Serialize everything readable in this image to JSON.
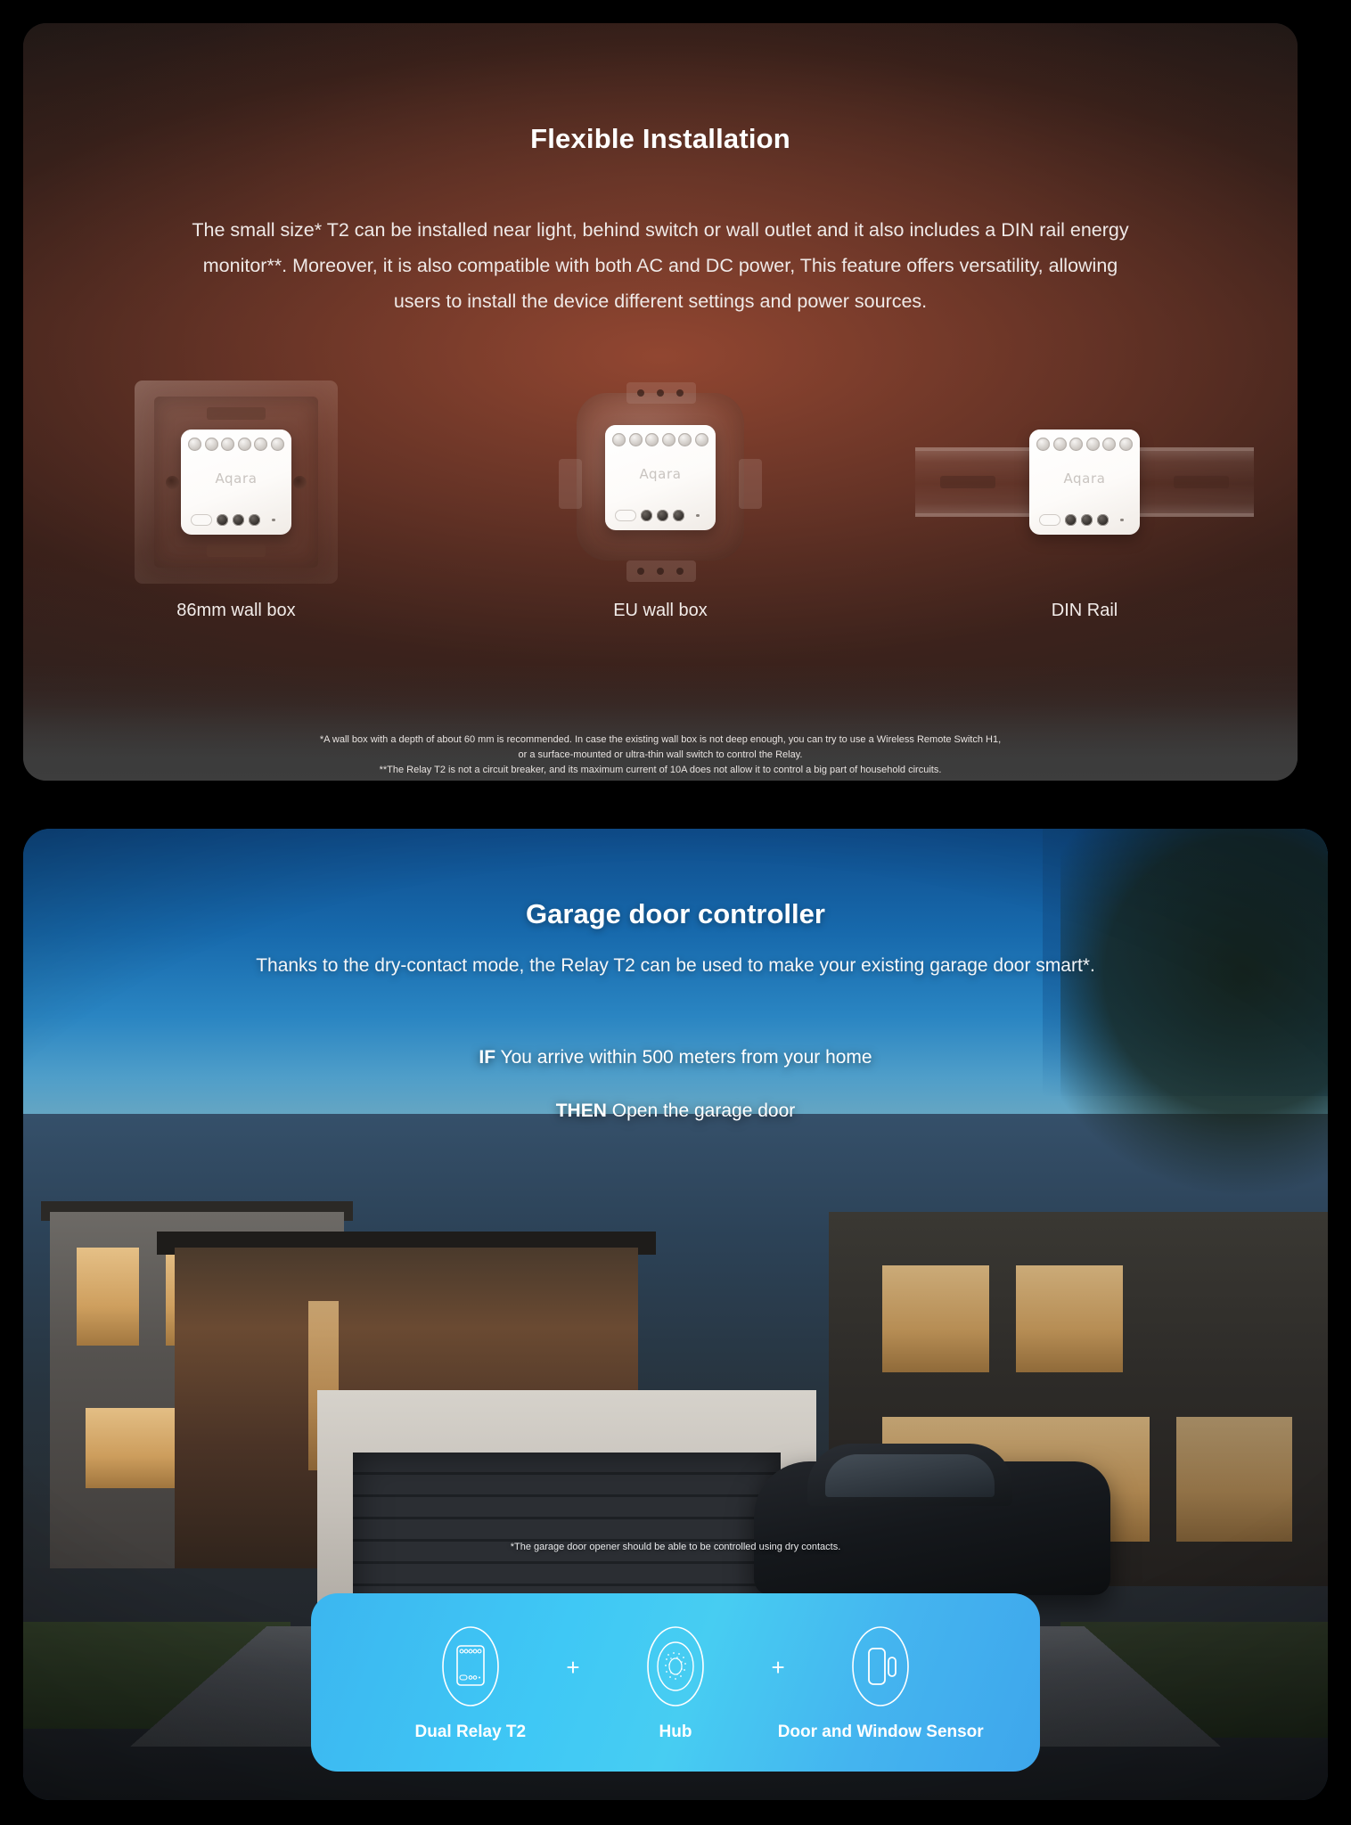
{
  "page": {
    "background_color": "#000000"
  },
  "section1": {
    "title": "Flexible Installation",
    "paragraph": "The small size* T2 can be installed near light, behind switch or wall outlet and it also includes a DIN rail energy monitor**. Moreover, it is also compatible with both AC and DC power, This feature offers versatility, allowing users to install the device different settings and power sources.",
    "devices": [
      {
        "label": "86mm wall box",
        "icon": "wall-box-86mm-icon",
        "brand": "Aqara"
      },
      {
        "label": "EU wall box",
        "icon": "eu-wall-box-icon",
        "brand": "Aqara"
      },
      {
        "label": "DIN Rail",
        "icon": "din-rail-icon",
        "brand": "Aqara"
      }
    ],
    "footnotes": [
      "*A wall box with a depth of about 60 mm is recommended. In case the existing wall box is not deep enough, you can try to use a Wireless Remote Switch H1,",
      "or a surface-mounted or ultra-thin wall switch to control the Relay.",
      "**The Relay T2 is not a circuit breaker, and its maximum current of 10A does not allow it to control a big part of household circuits."
    ],
    "accent_color": "#8a4634"
  },
  "section2": {
    "title": "Garage door controller",
    "subtitle": "Thanks to the dry-contact mode, the Relay T2 can be used to make your existing garage door smart*.",
    "automation": {
      "if_keyword": "IF",
      "if_text": "You arrive within 500 meters from your home",
      "then_keyword": "THEN",
      "then_text": "Open the garage door"
    },
    "footnote": "*The garage door opener should be able to be controlled using dry contacts.",
    "combo": {
      "accent_color": "#3fc4f3",
      "items": [
        {
          "label": "Dual Relay T2",
          "icon": "relay-module-icon"
        },
        {
          "label": "Hub",
          "icon": "hub-icon"
        },
        {
          "label": "Door and Window Sensor",
          "icon": "door-window-sensor-icon"
        }
      ],
      "separators": [
        "+",
        "+"
      ]
    }
  }
}
